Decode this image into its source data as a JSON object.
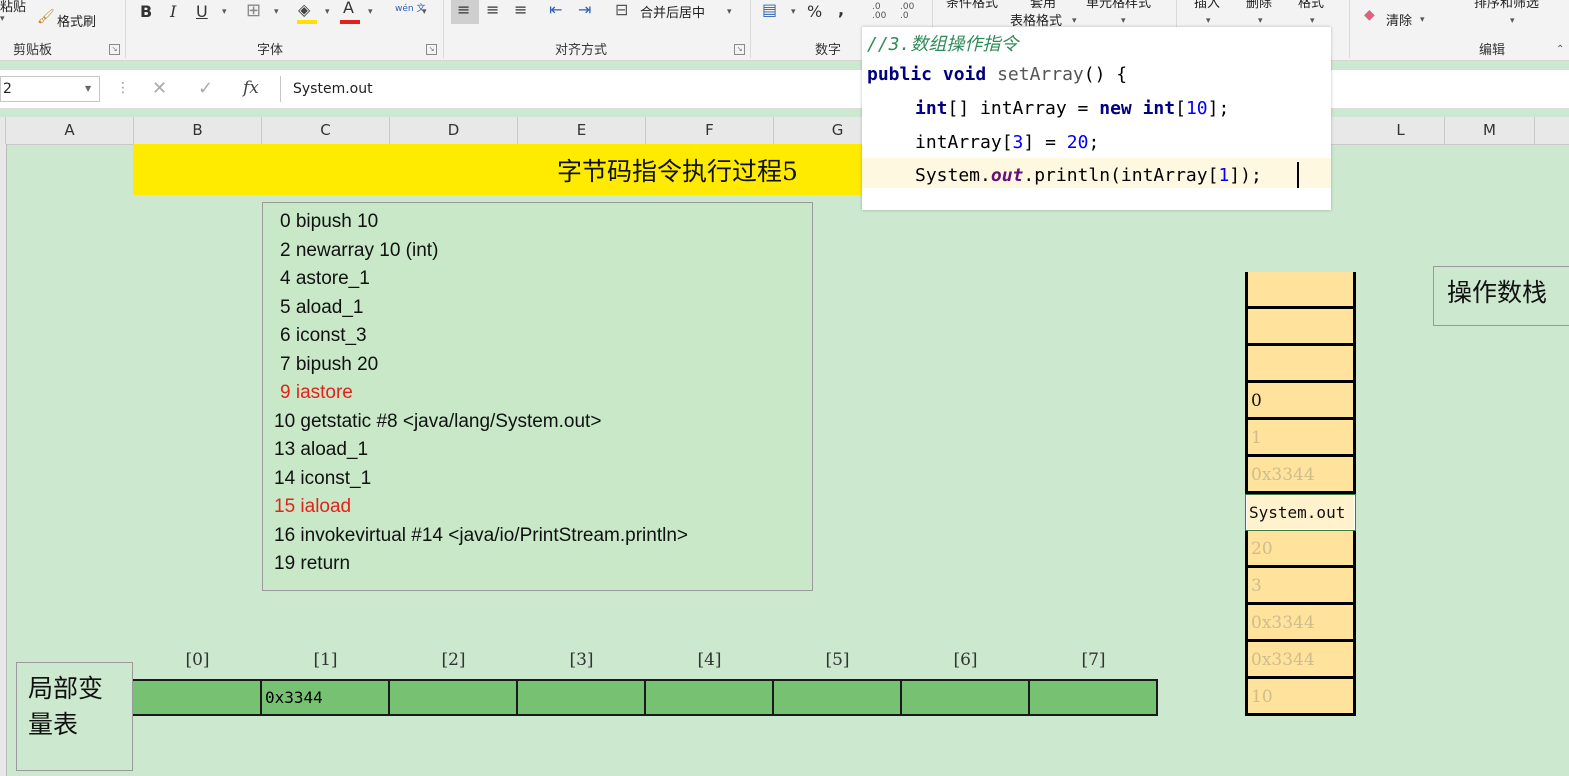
{
  "ribbon": {
    "clipboard": {
      "paste": "粘贴",
      "format_painter": "格式刷",
      "group": "剪贴板"
    },
    "font": {
      "group": "字体",
      "bold": "B",
      "italic": "I",
      "underline": "U",
      "font_color": "A",
      "wen": "wén 文"
    },
    "alignment": {
      "group": "对齐方式",
      "merge_center": "合并后居中"
    },
    "number": {
      "group": "数字",
      "percent": "%",
      "comma": ",",
      "inc_decimal": ".0 .00",
      "dec_decimal": ".00 .0"
    },
    "styles": {
      "conditional": "条件格式",
      "table_format_top": "套用",
      "table_format": "表格格式",
      "cell_styles": "单元格样式"
    },
    "cells": {
      "insert": "插入",
      "delete": "删除",
      "format": "格式"
    },
    "editing": {
      "clear": "清除",
      "sort_filter": "排序和筛选",
      "group": "编辑"
    }
  },
  "formula_bar": {
    "name_box": "2",
    "cancel": "✕",
    "confirm": "✓",
    "fx": "fx",
    "value": "System.out"
  },
  "columns": [
    "A",
    "B",
    "C",
    "D",
    "E",
    "F",
    "G",
    "L",
    "M"
  ],
  "sheet": {
    "title": "字节码指令执行过程5",
    "bytecode": [
      {
        "text": "0 bipush 10",
        "hl": false
      },
      {
        "text": "2 newarray 10 (int)",
        "hl": false
      },
      {
        "text": "4 astore_1",
        "hl": false
      },
      {
        "text": "5 aload_1",
        "hl": false
      },
      {
        "text": "6 iconst_3",
        "hl": false
      },
      {
        "text": "7 bipush 20",
        "hl": false
      },
      {
        "text": "9 iastore",
        "hl": true
      },
      {
        "text": "10 getstatic #8 <java/lang/System.out>",
        "hl": false
      },
      {
        "text": "13 aload_1",
        "hl": false
      },
      {
        "text": "14 iconst_1",
        "hl": false
      },
      {
        "text": "15 iaload",
        "hl": true
      },
      {
        "text": "16 invokevirtual #14 <java/io/PrintStream.println>",
        "hl": false
      },
      {
        "text": "19 return",
        "hl": false
      }
    ],
    "code_popup": {
      "comment": "//3.数组操作指令",
      "line1_kw1": "public",
      "line1_kw2": "void",
      "line1_fn": "setArray",
      "line1_rest": "() {",
      "line2_kw": "int",
      "line2_mid": "[] intArray = ",
      "line2_new": "new",
      "line2_int": "int",
      "line2_num": "10",
      "line3_a": "intArray[",
      "line3_n1": "3",
      "line3_b": "] = ",
      "line3_n2": "20",
      "line3_c": ";",
      "line4_a": "System.",
      "line4_out": "out",
      "line4_b": ".println(intArray[",
      "line4_n": "1",
      "line4_c": "]);"
    },
    "operand_stack": {
      "label": "操作数栈",
      "cells": [
        {
          "text": "",
          "state": "active"
        },
        {
          "text": "",
          "state": "active"
        },
        {
          "text": "",
          "state": "active"
        },
        {
          "text": "0",
          "state": "active"
        },
        {
          "text": "1",
          "state": "faded"
        },
        {
          "text": "0x3344",
          "state": "faded"
        },
        {
          "text": "System.out",
          "state": "sel"
        },
        {
          "text": "20",
          "state": "faded"
        },
        {
          "text": "3",
          "state": "faded"
        },
        {
          "text": "0x3344",
          "state": "faded"
        },
        {
          "text": "0x3344",
          "state": "faded"
        },
        {
          "text": "10",
          "state": "faded"
        }
      ]
    },
    "local_vars": {
      "label_line1": "局部变",
      "label_line2": "量表",
      "indices": [
        "[0]",
        "[1]",
        "[2]",
        "[3]",
        "[4]",
        "[5]",
        "[6]",
        "[7]"
      ],
      "values": [
        "",
        "0x3344",
        "",
        "",
        "",
        "",
        "",
        ""
      ]
    }
  }
}
